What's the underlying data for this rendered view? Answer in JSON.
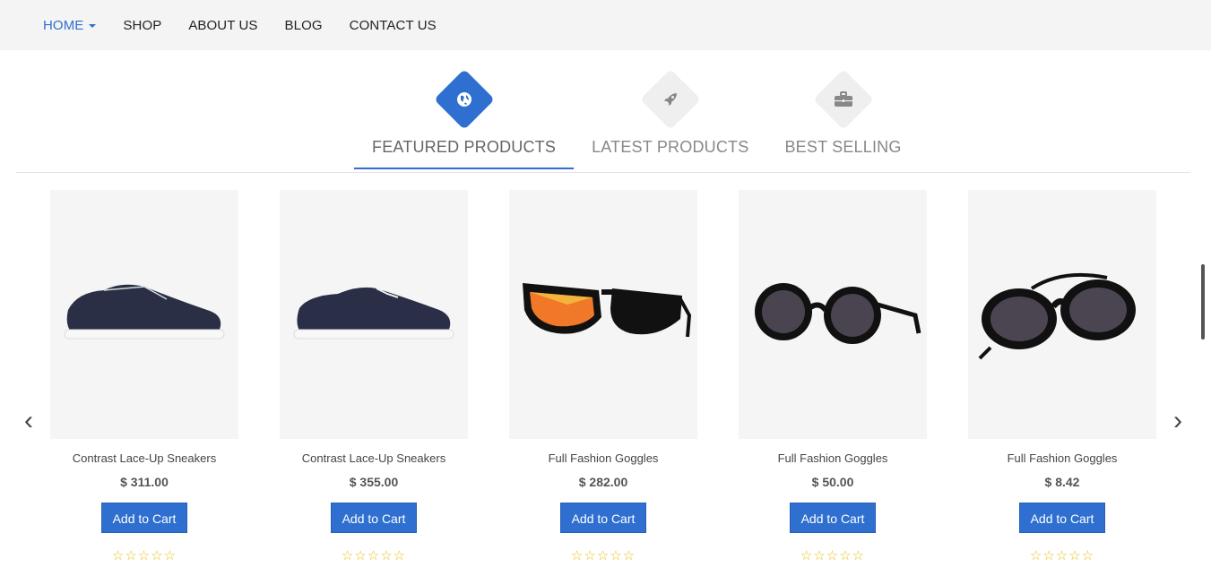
{
  "nav": {
    "items": [
      {
        "label": "HOME",
        "active": true
      },
      {
        "label": "SHOP"
      },
      {
        "label": "ABOUT US"
      },
      {
        "label": "BLOG"
      },
      {
        "label": "CONTACT US"
      }
    ]
  },
  "tabs": [
    {
      "label": "FEATURED PRODUCTS",
      "icon": "globe-icon",
      "active": true
    },
    {
      "label": "LATEST PRODUCTS",
      "icon": "rocket-icon"
    },
    {
      "label": "BEST SELLING",
      "icon": "briefcase-icon"
    }
  ],
  "products": [
    {
      "name": "Contrast Lace-Up Sneakers",
      "price": "$ 311.00",
      "button": "Add to Cart",
      "stars": "☆☆☆☆☆",
      "image": "sneaker"
    },
    {
      "name": "Contrast Lace-Up Sneakers",
      "price": "$ 355.00",
      "button": "Add to Cart",
      "stars": "☆☆☆☆☆",
      "image": "sneaker"
    },
    {
      "name": "Full Fashion Goggles",
      "price": "$ 282.00",
      "button": "Add to Cart",
      "stars": "☆☆☆☆☆",
      "image": "wayfarer-sunglasses"
    },
    {
      "name": "Full Fashion Goggles",
      "price": "$ 50.00",
      "button": "Add to Cart",
      "stars": "☆☆☆☆☆",
      "image": "round-sunglasses"
    },
    {
      "name": "Full Fashion Goggles",
      "price": "$ 8.42",
      "button": "Add to Cart",
      "stars": "☆☆☆☆☆",
      "image": "steampunk-goggles"
    }
  ],
  "carousel": {
    "prev_icon": "‹",
    "next_icon": "›"
  },
  "colors": {
    "accent": "#2f6fcf",
    "star": "#e8c21b"
  }
}
